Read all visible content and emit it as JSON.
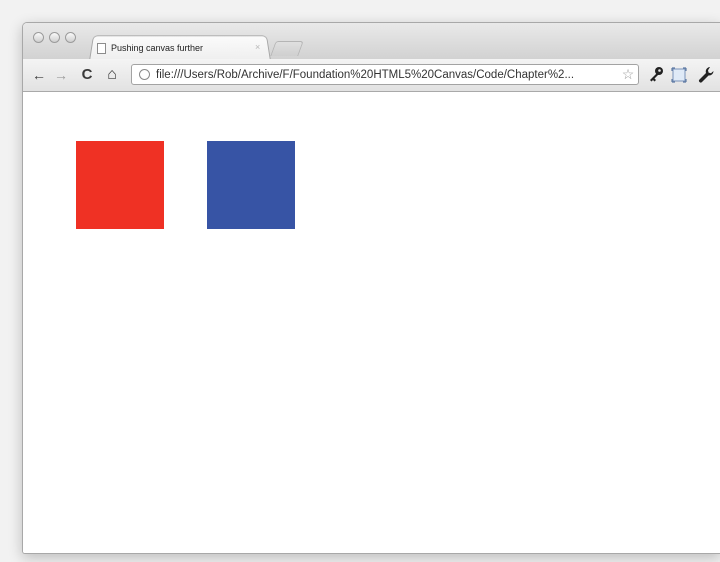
{
  "tab": {
    "title": "Pushing canvas further",
    "close_glyph": "×"
  },
  "toolbar": {
    "back_glyph": "←",
    "forward_glyph": "→",
    "reload_glyph": "C",
    "home_glyph": "⌂",
    "url": "file:///Users/Rob/Archive/F/Foundation%20HTML5%20Canvas/Code/Chapter%2...",
    "star_glyph": "☆",
    "icons": [
      "back-icon",
      "forward-icon",
      "reload-icon",
      "home-icon",
      "globe-icon",
      "star-icon",
      "key-icon",
      "page-icon",
      "wrench-icon"
    ]
  },
  "canvas": {
    "squares": [
      {
        "name": "red-square",
        "color": "#ef3124"
      },
      {
        "name": "blue-square",
        "color": "#3754a5"
      }
    ]
  }
}
